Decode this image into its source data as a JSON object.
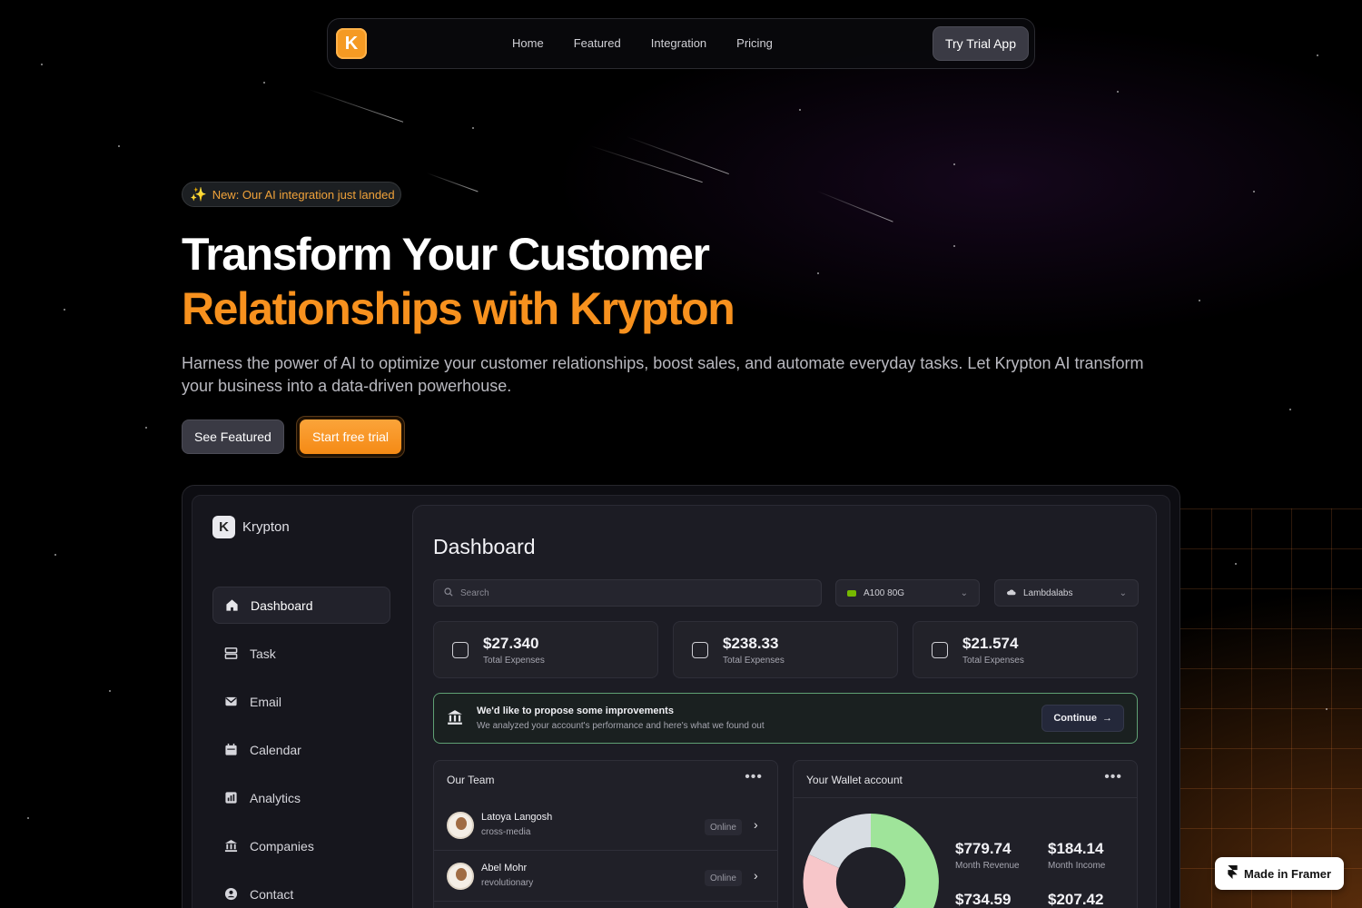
{
  "nav": {
    "logo_glyph": "K",
    "links": [
      "Home",
      "Featured",
      "Integration",
      "Pricing"
    ],
    "cta": "Try Trial App"
  },
  "hero": {
    "badge": "New: Our AI integration just landed",
    "title_line1": "Transform Your Customer",
    "title_line2": "Relationships with Krypton",
    "description": "Harness the power of AI to optimize your customer relationships, boost sales, and automate everyday tasks. Let Krypton AI transform your business into a data-driven powerhouse.",
    "secondary_button": "See Featured",
    "primary_button": "Start free trial"
  },
  "app": {
    "brand": "Krypton",
    "sidebar": [
      {
        "label": "Dashboard",
        "icon": "home-icon"
      },
      {
        "label": "Task",
        "icon": "task-icon"
      },
      {
        "label": "Email",
        "icon": "mail-icon"
      },
      {
        "label": "Calendar",
        "icon": "calendar-icon"
      },
      {
        "label": "Analytics",
        "icon": "analytics-icon"
      },
      {
        "label": "Companies",
        "icon": "building-icon"
      },
      {
        "label": "Contact",
        "icon": "contact-icon"
      }
    ],
    "main_title": "Dashboard",
    "search_placeholder": "Search",
    "select_gpu": "A100 80G",
    "select_provider": "Lambdalabs",
    "stats": [
      {
        "value": "$27.340",
        "label": "Total Expenses"
      },
      {
        "value": "$238.33",
        "label": "Total Expenses"
      },
      {
        "value": "$21.574",
        "label": "Total Expenses"
      }
    ],
    "banner": {
      "title": "We'd like to propose some improvements",
      "subtitle": "We analyzed your account's performance and here's what we found out",
      "button": "Continue"
    },
    "team": {
      "title": "Our Team",
      "members": [
        {
          "name": "Latoya Langosh",
          "role": "cross-media",
          "status": "Online"
        },
        {
          "name": "Abel Mohr",
          "role": "revolutionary",
          "status": "Online"
        }
      ]
    },
    "wallet": {
      "title": "Your Wallet account",
      "items": [
        {
          "value": "$779.74",
          "label": "Month Revenue"
        },
        {
          "value": "$184.14",
          "label": "Month Income"
        },
        {
          "value": "$734.59",
          "label": ""
        },
        {
          "value": "$207.42",
          "label": ""
        }
      ]
    }
  },
  "framer_badge": "Made in Framer",
  "colors": {
    "accent": "#f7911e",
    "background": "#000000",
    "banner_border": "#5fa074"
  }
}
